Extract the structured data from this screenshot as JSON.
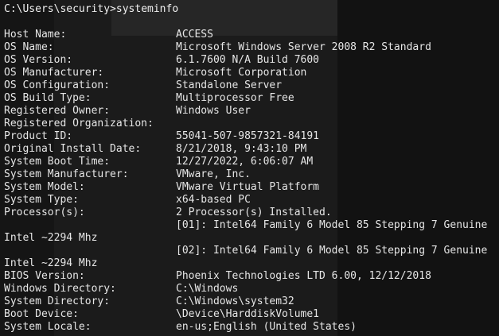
{
  "prompt": {
    "path": "C:\\Users\\security>",
    "command": "systeminfo"
  },
  "rows": [
    {
      "key": "Host Name:",
      "value": "ACCESS"
    },
    {
      "key": "OS Name:",
      "value": "Microsoft Windows Server 2008 R2 Standard"
    },
    {
      "key": "OS Version:",
      "value": "6.1.7600 N/A Build 7600"
    },
    {
      "key": "OS Manufacturer:",
      "value": "Microsoft Corporation"
    },
    {
      "key": "OS Configuration:",
      "value": "Standalone Server"
    },
    {
      "key": "OS Build Type:",
      "value": "Multiprocessor Free"
    },
    {
      "key": "Registered Owner:",
      "value": "Windows User"
    },
    {
      "key": "Registered Organization:",
      "value": ""
    },
    {
      "key": "Product ID:",
      "value": "55041-507-9857321-84191"
    },
    {
      "key": "Original Install Date:",
      "value": "8/21/2018, 9:43:10 PM"
    },
    {
      "key": "System Boot Time:",
      "value": "12/27/2022, 6:06:07 AM"
    },
    {
      "key": "System Manufacturer:",
      "value": "VMware, Inc."
    },
    {
      "key": "System Model:",
      "value": "VMware Virtual Platform"
    },
    {
      "key": "System Type:",
      "value": "x64-based PC"
    },
    {
      "key": "Processor(s):",
      "value": "2 Processor(s) Installed."
    }
  ],
  "processors": [
    {
      "line": "[01]: Intel64 Family 6 Model 85 Stepping 7 Genuine",
      "wrap": "Intel ~2294 Mhz"
    },
    {
      "line": "[02]: Intel64 Family 6 Model 85 Stepping 7 Genuine",
      "wrap": "Intel ~2294 Mhz"
    }
  ],
  "rows_after": [
    {
      "key": "BIOS Version:",
      "value": "Phoenix Technologies LTD 6.00, 12/12/2018"
    },
    {
      "key": "Windows Directory:",
      "value": "C:\\Windows"
    },
    {
      "key": "System Directory:",
      "value": "C:\\Windows\\system32"
    },
    {
      "key": "Boot Device:",
      "value": "\\Device\\HarddiskVolume1"
    },
    {
      "key": "System Locale:",
      "value": "en-us;English (United States)"
    }
  ]
}
